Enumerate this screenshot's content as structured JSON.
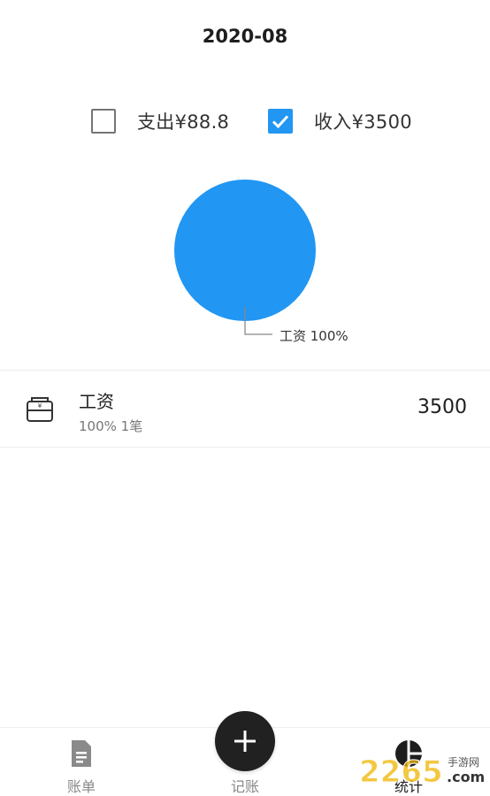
{
  "header": {
    "title": "2020-08"
  },
  "filters": {
    "expense": {
      "label": "支出¥88.8",
      "checked": false
    },
    "income": {
      "label": "收入¥3500",
      "checked": true
    }
  },
  "chart_data": {
    "type": "pie",
    "slices": [
      {
        "label": "工资 100%",
        "value": 100,
        "color": "#2196f3"
      }
    ]
  },
  "categories": [
    {
      "icon": "wallet-icon",
      "name": "工资",
      "detail": "100% 1笔",
      "amount": "3500"
    }
  ],
  "nav": {
    "bills": {
      "label": "账单",
      "icon": "document-icon"
    },
    "record": {
      "label": "记账",
      "icon": "plus-icon"
    },
    "stats": {
      "label": "统计",
      "icon": "pie-chart-icon"
    }
  },
  "watermark": {
    "brand_text": "2265",
    "suffix_cn": "手游网",
    "suffix_en": ".com"
  },
  "colors": {
    "accent": "#2196f3",
    "fab": "#212121",
    "watermark": "#f0b400"
  }
}
